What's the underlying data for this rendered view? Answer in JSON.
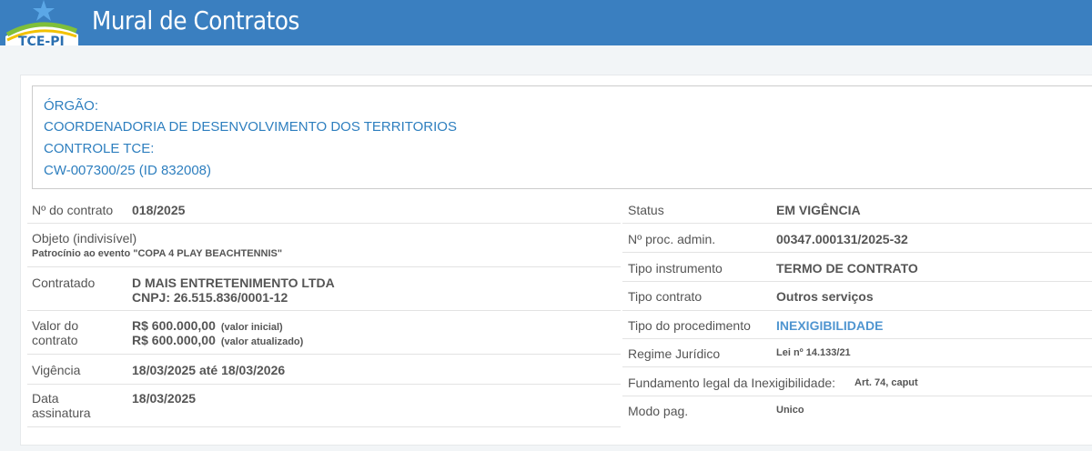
{
  "header": {
    "logo_text": "TCE-PI",
    "title": "Mural de Contratos"
  },
  "orgao": {
    "label": "ÓRGÃO:",
    "value": "COORDENADORIA DE DESENVOLVIMENTO DOS TERRITORIOS",
    "controle_label": "CONTROLE TCE:",
    "controle_value": "CW-007300/25 (ID 832008)"
  },
  "left": {
    "numero": {
      "label": "Nº do contrato",
      "value": "018/2025"
    },
    "objeto": {
      "label": "Objeto (indivisível)",
      "value": "Patrocínio ao evento \"COPA 4 PLAY BEACHTENNIS\""
    },
    "contratado": {
      "label": "Contratado",
      "name": "D MAIS ENTRETENIMENTO LTDA",
      "cnpj": "CNPJ: 26.515.836/0001-12"
    },
    "valor": {
      "label_line1": "Valor do",
      "label_line2": "contrato",
      "inicial": "R$ 600.000,00",
      "inicial_note": "(valor inicial)",
      "atualizado": "R$ 600.000,00",
      "atualizado_note": "(valor atualizado)"
    },
    "vigencia": {
      "label": "Vigência",
      "value": "18/03/2025 até 18/03/2026"
    },
    "assinatura": {
      "label_line1": "Data",
      "label_line2": "assinatura",
      "value": "18/03/2025"
    }
  },
  "right": {
    "status": {
      "label": "Status",
      "value": "EM VIGÊNCIA"
    },
    "proc": {
      "label": "Nº proc. admin.",
      "value": "00347.000131/2025-32"
    },
    "tipo_instrumento": {
      "label": "Tipo instrumento",
      "value": "TERMO DE CONTRATO"
    },
    "tipo_contrato": {
      "label": "Tipo contrato",
      "value": "Outros serviços"
    },
    "tipo_procedimento": {
      "label": "Tipo do procedimento",
      "value": "INEXIGIBILIDADE"
    },
    "regime": {
      "label": "Regime Jurídico",
      "value": "Lei nº 14.133/21"
    },
    "fundamento": {
      "label": "Fundamento legal da Inexigibilidade:",
      "value": "Art. 74, caput"
    },
    "modo_pag": {
      "label": "Modo pag.",
      "value": "Unico"
    }
  },
  "colors": {
    "header_bg": "#3a7fc0",
    "link": "#2e7fbf"
  }
}
